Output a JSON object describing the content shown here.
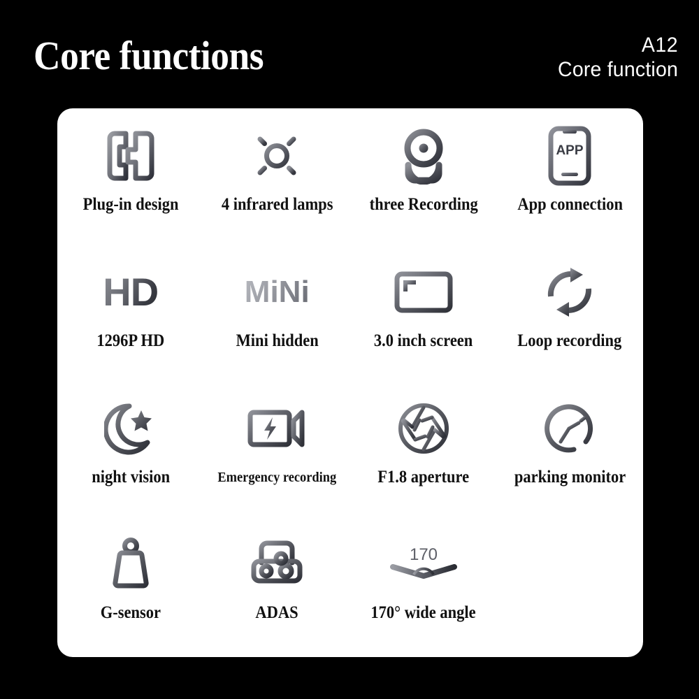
{
  "header": {
    "title": "Core functions",
    "model_code": "A12",
    "model_subtitle": "Core function"
  },
  "colors": {
    "background": "#000000",
    "card": "#ffffff",
    "title_text": "#ffffff",
    "label_text": "#111111",
    "icon_gradient_light": "#8d8f96",
    "icon_gradient_dark": "#2b2d33"
  },
  "card": {
    "features": [
      {
        "icon": "plug-in-design-icon",
        "label": "Plug-in design",
        "size": "normal"
      },
      {
        "icon": "sun-brightness-icon",
        "label": "4 infrared lamps",
        "size": "normal"
      },
      {
        "icon": "webcam-icon",
        "label": "three Recording",
        "size": "normal"
      },
      {
        "icon": "phone-app-icon",
        "label": "App connection",
        "size": "normal",
        "glyph_text": "APP"
      },
      {
        "icon": "hd-text-icon",
        "label": "1296P HD",
        "size": "normal",
        "glyph_text": "HD"
      },
      {
        "icon": "mini-text-icon",
        "label": "Mini hidden",
        "size": "normal",
        "glyph_text": "MiNi"
      },
      {
        "icon": "screen-icon",
        "label": "3.0 inch screen",
        "size": "normal"
      },
      {
        "icon": "loop-recording-icon",
        "label": "Loop recording",
        "size": "normal"
      },
      {
        "icon": "moon-star-icon",
        "label": "night vision",
        "size": "normal"
      },
      {
        "icon": "video-camera-bolt-icon",
        "label": "Emergency recording",
        "size": "small"
      },
      {
        "icon": "aperture-icon",
        "label": "F1.8 aperture",
        "size": "normal"
      },
      {
        "icon": "gauge-clock-icon",
        "label": "parking monitor",
        "size": "normal"
      },
      {
        "icon": "weight-icon",
        "label": "G-sensor",
        "size": "normal"
      },
      {
        "icon": "car-front-icon",
        "label": "ADAS",
        "size": "normal"
      },
      {
        "icon": "wide-angle-icon",
        "label": "170°  wide angle",
        "size": "normal",
        "glyph_text": "170"
      }
    ]
  }
}
